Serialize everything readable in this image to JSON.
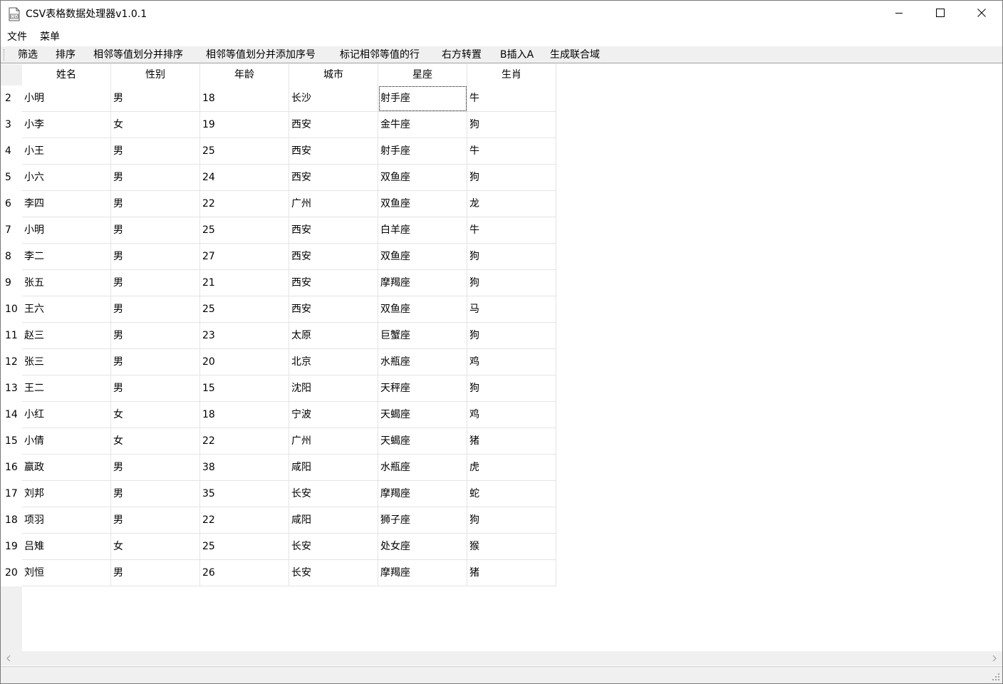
{
  "window": {
    "title": "CSV表格数据处理器v1.0.1",
    "icon": "csv-file-icon"
  },
  "menubar": {
    "items": [
      "文件",
      "菜单"
    ]
  },
  "toolbar": {
    "items": [
      "筛选",
      "排序",
      "相邻等值划分并排序",
      "相邻等值划分并添加序号",
      "标记相邻等值的行",
      "右方转置",
      "B插入A",
      "生成联合域"
    ]
  },
  "table": {
    "columns": [
      "姓名",
      "性别",
      "年龄",
      "城市",
      "星座",
      "生肖"
    ],
    "rows": [
      {
        "num": "2",
        "cells": [
          "小明",
          "男",
          "18",
          "长沙",
          "射手座",
          "牛"
        ]
      },
      {
        "num": "3",
        "cells": [
          "小李",
          "女",
          "19",
          "西安",
          "金牛座",
          "狗"
        ]
      },
      {
        "num": "4",
        "cells": [
          "小王",
          "男",
          "25",
          "西安",
          "射手座",
          "牛"
        ]
      },
      {
        "num": "5",
        "cells": [
          "小六",
          "男",
          "24",
          "西安",
          "双鱼座",
          "狗"
        ]
      },
      {
        "num": "6",
        "cells": [
          "李四",
          "男",
          "22",
          "广州",
          "双鱼座",
          "龙"
        ]
      },
      {
        "num": "7",
        "cells": [
          "小明",
          "男",
          "25",
          "西安",
          "白羊座",
          "牛"
        ]
      },
      {
        "num": "8",
        "cells": [
          "李二",
          "男",
          "27",
          "西安",
          "双鱼座",
          "狗"
        ]
      },
      {
        "num": "9",
        "cells": [
          "张五",
          "男",
          "21",
          "西安",
          "摩羯座",
          "狗"
        ]
      },
      {
        "num": "10",
        "cells": [
          "王六",
          "男",
          "25",
          "西安",
          "双鱼座",
          "马"
        ]
      },
      {
        "num": "11",
        "cells": [
          "赵三",
          "男",
          "23",
          "太原",
          "巨蟹座",
          "狗"
        ]
      },
      {
        "num": "12",
        "cells": [
          "张三",
          "男",
          "20",
          "北京",
          "水瓶座",
          "鸡"
        ]
      },
      {
        "num": "13",
        "cells": [
          "王二",
          "男",
          "15",
          "沈阳",
          "天秤座",
          "狗"
        ]
      },
      {
        "num": "14",
        "cells": [
          "小红",
          "女",
          "18",
          "宁波",
          "天蝎座",
          "鸡"
        ]
      },
      {
        "num": "15",
        "cells": [
          "小倩",
          "女",
          "22",
          "广州",
          "天蝎座",
          "猪"
        ]
      },
      {
        "num": "16",
        "cells": [
          "嬴政",
          "男",
          "38",
          "咸阳",
          "水瓶座",
          "虎"
        ]
      },
      {
        "num": "17",
        "cells": [
          "刘邦",
          "男",
          "35",
          "长安",
          "摩羯座",
          "蛇"
        ]
      },
      {
        "num": "18",
        "cells": [
          "项羽",
          "男",
          "22",
          "咸阳",
          "狮子座",
          "狗"
        ]
      },
      {
        "num": "19",
        "cells": [
          "吕雉",
          "女",
          "25",
          "长安",
          "处女座",
          "猴"
        ]
      },
      {
        "num": "20",
        "cells": [
          "刘恒",
          "男",
          "26",
          "长安",
          "摩羯座",
          "猪"
        ]
      }
    ],
    "selected_cell": {
      "row": 0,
      "col": 4
    }
  },
  "icons": {
    "minimize": "minimize-icon",
    "maximize": "maximize-icon",
    "close": "close-icon",
    "scroll_left": "scroll-left-arrow-icon",
    "scroll_right": "scroll-right-arrow-icon",
    "size_grip": "size-grip-icon"
  }
}
